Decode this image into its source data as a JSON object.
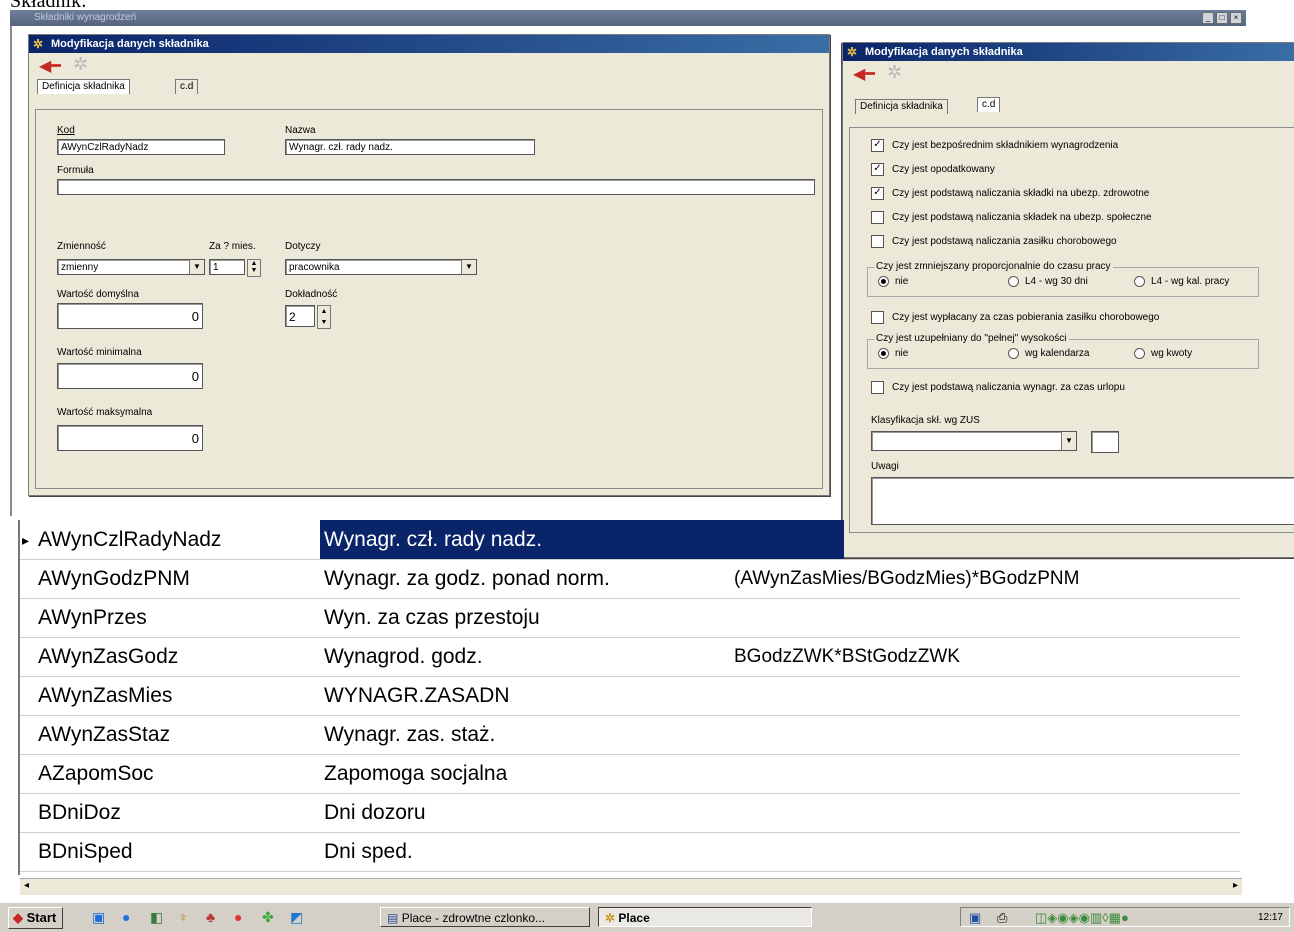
{
  "doc_caption": "Składnik:",
  "app_window": {
    "title": "Składniki wynagrodzeń"
  },
  "dialog_left": {
    "title": "Modyfikacja danych składnika",
    "tabs": [
      "Definicja składnika",
      "c.d"
    ],
    "labels": {
      "kod": "Kod",
      "nazwa": "Nazwa",
      "formula": "Formuła",
      "zmiennosc": "Zmienność",
      "za_mies": "Za ? mies.",
      "dotyczy": "Dotyczy",
      "wartosc_domyslna": "Wartość domyślna",
      "dokladnosc": "Dokładność",
      "wartosc_minimalna": "Wartość minimalna",
      "wartosc_maksymalna": "Wartość maksymalna"
    },
    "values": {
      "kod": "AWynCzlRadyNadz",
      "nazwa": "Wynagr. czł. rady nadz.",
      "formula": "",
      "zmiennosc": "zmienny",
      "za_mies": "1",
      "dotyczy": "pracownika",
      "wartosc_domyslna": "0",
      "dokladnosc": "2",
      "wartosc_minimalna": "0",
      "wartosc_maksymalna": "0"
    }
  },
  "dialog_right": {
    "title": "Modyfikacja danych składnika",
    "tabs": [
      "Definicja składnika",
      "c.d"
    ],
    "checkboxes": [
      {
        "label": "Czy jest bezpośrednim składnikiem wynagrodzenia",
        "checked": true
      },
      {
        "label": "Czy jest opodatkowany",
        "checked": true
      },
      {
        "label": "Czy jest podstawą naliczania składki na ubezp. zdrowotne",
        "checked": true
      },
      {
        "label": "Czy jest podstawą naliczania składek na ubezp. społeczne",
        "checked": false
      },
      {
        "label": "Czy jest podstawą naliczania zasiłku chorobowego",
        "checked": false
      }
    ],
    "group_reduce": {
      "title": "Czy jest zmniejszany proporcjonalnie do czasu pracy",
      "options": [
        "nie",
        "L4 - wg 30 dni",
        "L4 - wg kal. pracy"
      ],
      "selected": "nie"
    },
    "checkbox_sick": {
      "label": "Czy jest wypłacany za czas pobierania zasiłku chorobowego",
      "checked": false
    },
    "group_fill": {
      "title": "Czy jest uzupełniany do \"pełnej\" wysokości",
      "options": [
        "nie",
        "wg kalendarza",
        "wg kwoty"
      ],
      "selected": "nie"
    },
    "checkbox_vacation": {
      "label": "Czy jest podstawą naliczania wynagr. za czas urlopu",
      "checked": false
    },
    "zus_label": "Klasyfikacja skł. wg ZUS",
    "zus_value": "",
    "uwagi_label": "Uwagi",
    "uwagi_value": ""
  },
  "grid": {
    "rows": [
      {
        "code": "AWynCzlRadyNadz",
        "name": "Wynagr. czł. rady nadz.",
        "formula": "",
        "selected": true
      },
      {
        "code": "AWynGodzPNM",
        "name": "Wynagr. za godz. ponad norm.",
        "formula": "(AWynZasMies/BGodzMies)*BGodzPNM"
      },
      {
        "code": "AWynPrzes",
        "name": "Wyn. za czas przestoju",
        "formula": ""
      },
      {
        "code": "AWynZasGodz",
        "name": "Wynagrod. godz.",
        "formula": "BGodzZWK*BStGodzZWK"
      },
      {
        "code": "AWynZasMies",
        "name": "WYNAGR.ZASADN",
        "formula": ""
      },
      {
        "code": "AWynZasStaz",
        "name": "Wynagr. zas. staż.",
        "formula": ""
      },
      {
        "code": "AZapomSoc",
        "name": "Zapomoga socjalna",
        "formula": ""
      },
      {
        "code": "BDniDoz",
        "name": "Dni dozoru",
        "formula": ""
      },
      {
        "code": "BDniSped",
        "name": "Dni sped.",
        "formula": ""
      }
    ]
  },
  "taskbar": {
    "start_label": "Start",
    "buttons": [
      {
        "label": "Place - zdrowtne czlonko...",
        "active": false
      },
      {
        "label": "Place",
        "active": true
      }
    ],
    "clock": "12:17"
  },
  "colors": {
    "title_active": "#0a246a",
    "selection": "#0a246a",
    "dialog_bg": "#ece9d8"
  }
}
